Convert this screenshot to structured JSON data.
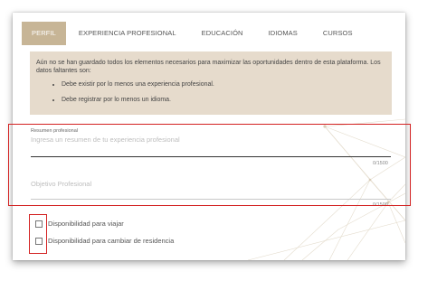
{
  "tabs": [
    {
      "label": "Perfil",
      "active": true
    },
    {
      "label": "Experiencia Profesional",
      "active": false
    },
    {
      "label": "Educación",
      "active": false
    },
    {
      "label": "Idiomas",
      "active": false
    },
    {
      "label": "Cursos",
      "active": false
    }
  ],
  "notice": {
    "text": "Aún no se han guardado todos los elementos necesarios para maximizar las oportunidades dentro de esta plataforma. Los datos faltantes son:",
    "items": [
      "Debe existir por lo menos una experiencia profesional.",
      "Debe registrar por lo menos un idioma."
    ]
  },
  "resumen": {
    "label": "Resumen profesional",
    "placeholder": "Ingresa un resumen de tu experiencia profesional",
    "counter": "0/1500"
  },
  "objetivo": {
    "placeholder": "Objetivo Profesional",
    "counter": "0/1500"
  },
  "checkboxes": [
    {
      "label": "Disponibilidad para viajar",
      "checked": false
    },
    {
      "label": "Disponibilidad para cambiar de residencia",
      "checked": false
    }
  ],
  "colors": {
    "accent": "#c7b596",
    "notice_bg": "#e6dbcc",
    "highlight": "#d32222"
  }
}
